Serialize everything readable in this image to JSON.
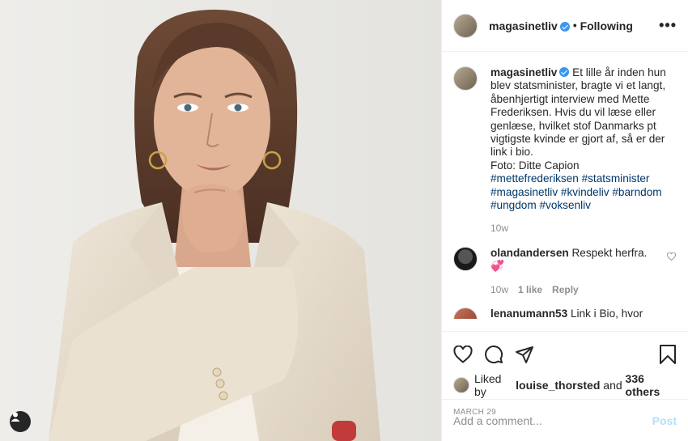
{
  "header": {
    "username": "magasinetliv",
    "dot": "•",
    "follow_label": "Following",
    "more_label": "•••"
  },
  "caption": {
    "username": "magasinetliv",
    "text": "Et lille år inden hun blev statsminister, bragte vi et langt, åbenhjertigt interview med Mette Frederiksen. Hvis du vil læse eller genlæse, hvilket stof Danmarks pt vigtigste kvinde er gjort af, så er der link i bio.",
    "photo_credit": "Foto: Ditte Capion",
    "hashtags": "#mettefrederiksen #statsminister #magasinetliv #kvindeliv #barndom #ungdom #voksenliv",
    "time": "10w"
  },
  "comments": [
    {
      "username": "olandandersen",
      "text": "Respekt herfra.",
      "emoji": "💞",
      "time": "10w",
      "likes": "1 like",
      "reply": "Reply"
    }
  ],
  "partial_comment": {
    "username": "lenanumann53",
    "text": "Link i Bio, hvor"
  },
  "likes": {
    "prefix": "Liked by",
    "user": "louise_thorsted",
    "and": "and",
    "others": "336 others"
  },
  "date": "MARCH 29",
  "add_comment": {
    "placeholder": "Add a comment...",
    "post_label": "Post"
  },
  "colors": {
    "link": "#00376b",
    "verified": "#3897f0",
    "post_disabled": "#b2dffc"
  },
  "icons": [
    "heart-icon",
    "comment-icon",
    "share-icon",
    "bookmark-icon",
    "user-tag-icon",
    "verified-icon"
  ]
}
